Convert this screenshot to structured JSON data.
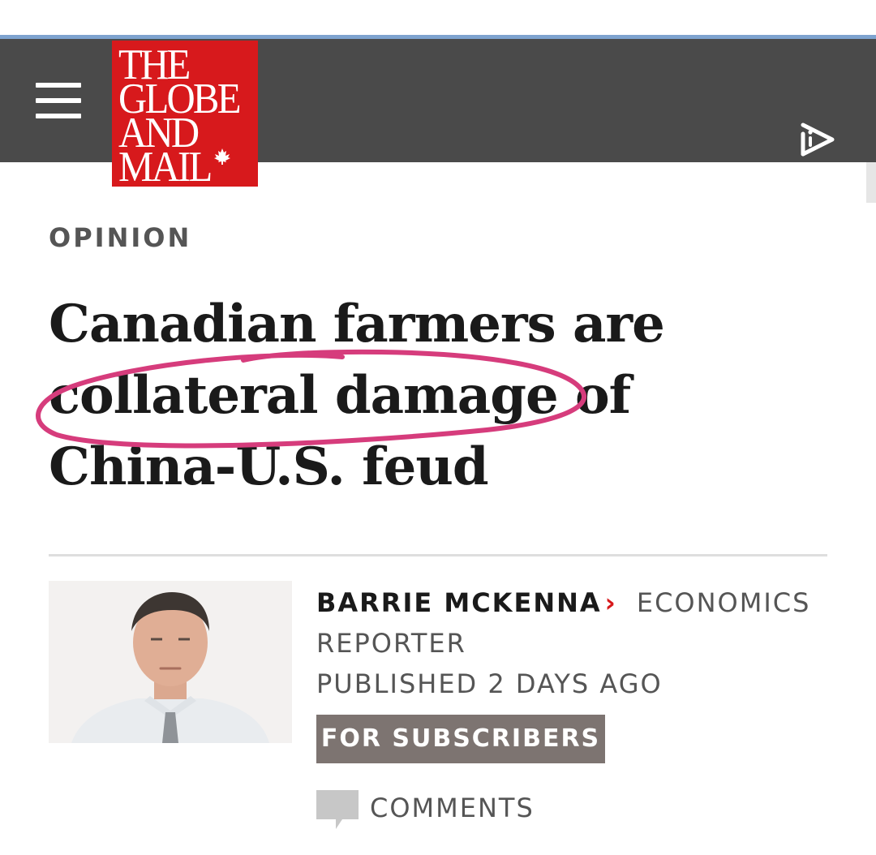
{
  "header": {
    "menu_icon": "hamburger-menu-icon",
    "logo": {
      "lines": [
        "THE",
        "GLOBE",
        "AND",
        "MAIL"
      ],
      "color": "#d7191c"
    },
    "play_icon": "audio-play-icon",
    "background": "#4a4a4a"
  },
  "article": {
    "section": "OPINION",
    "headline": "Canadian farmers are collateral damage of China-U.S. feud",
    "annotation_color": "#d63c7c",
    "author": {
      "name": "BARRIE MCKENNA",
      "chevron": "›",
      "role": "ECONOMICS REPORTER"
    },
    "published": "PUBLISHED 2 DAYS AGO",
    "badge": "FOR SUBSCRIBERS",
    "comments_label": "COMMENTS",
    "comments_icon": "comment-bubble-icon"
  }
}
